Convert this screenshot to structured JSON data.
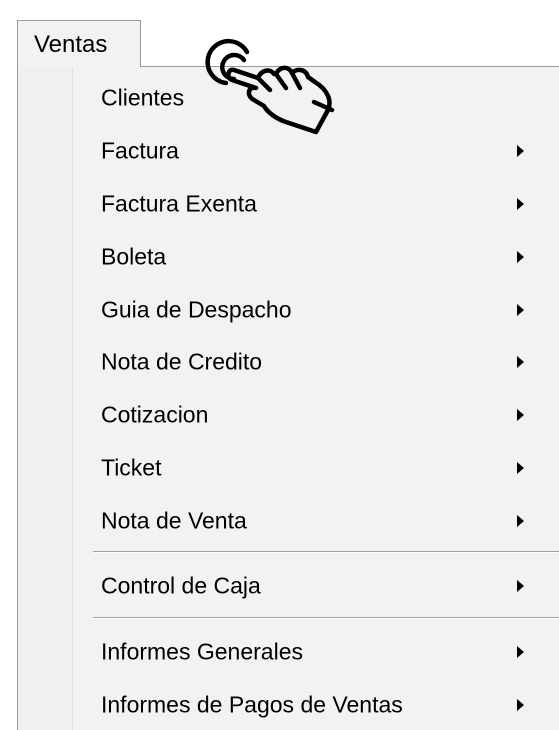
{
  "menu_bar": {
    "tab_label": "Ventas"
  },
  "dropdown": {
    "items": [
      {
        "label": "Clientes",
        "has_submenu": false
      },
      {
        "label": "Factura",
        "has_submenu": true
      },
      {
        "label": "Factura Exenta",
        "has_submenu": true
      },
      {
        "label": "Boleta",
        "has_submenu": true
      },
      {
        "label": "Guia de Despacho",
        "has_submenu": true
      },
      {
        "label": "Nota de Credito",
        "has_submenu": true
      },
      {
        "label": "Cotizacion",
        "has_submenu": true
      },
      {
        "label": "Ticket",
        "has_submenu": true
      },
      {
        "label": "Nota de Venta",
        "has_submenu": true
      },
      {
        "label": "Control de Caja",
        "has_submenu": true
      },
      {
        "label": "Informes Generales",
        "has_submenu": true
      },
      {
        "label": "Informes de Pagos de Ventas",
        "has_submenu": true
      }
    ]
  },
  "cursor": {
    "icon": "hand-pointer-click-icon"
  },
  "colors": {
    "menu_background": "#f2f2f2",
    "border": "#9a9a9a",
    "text": "#000000"
  }
}
